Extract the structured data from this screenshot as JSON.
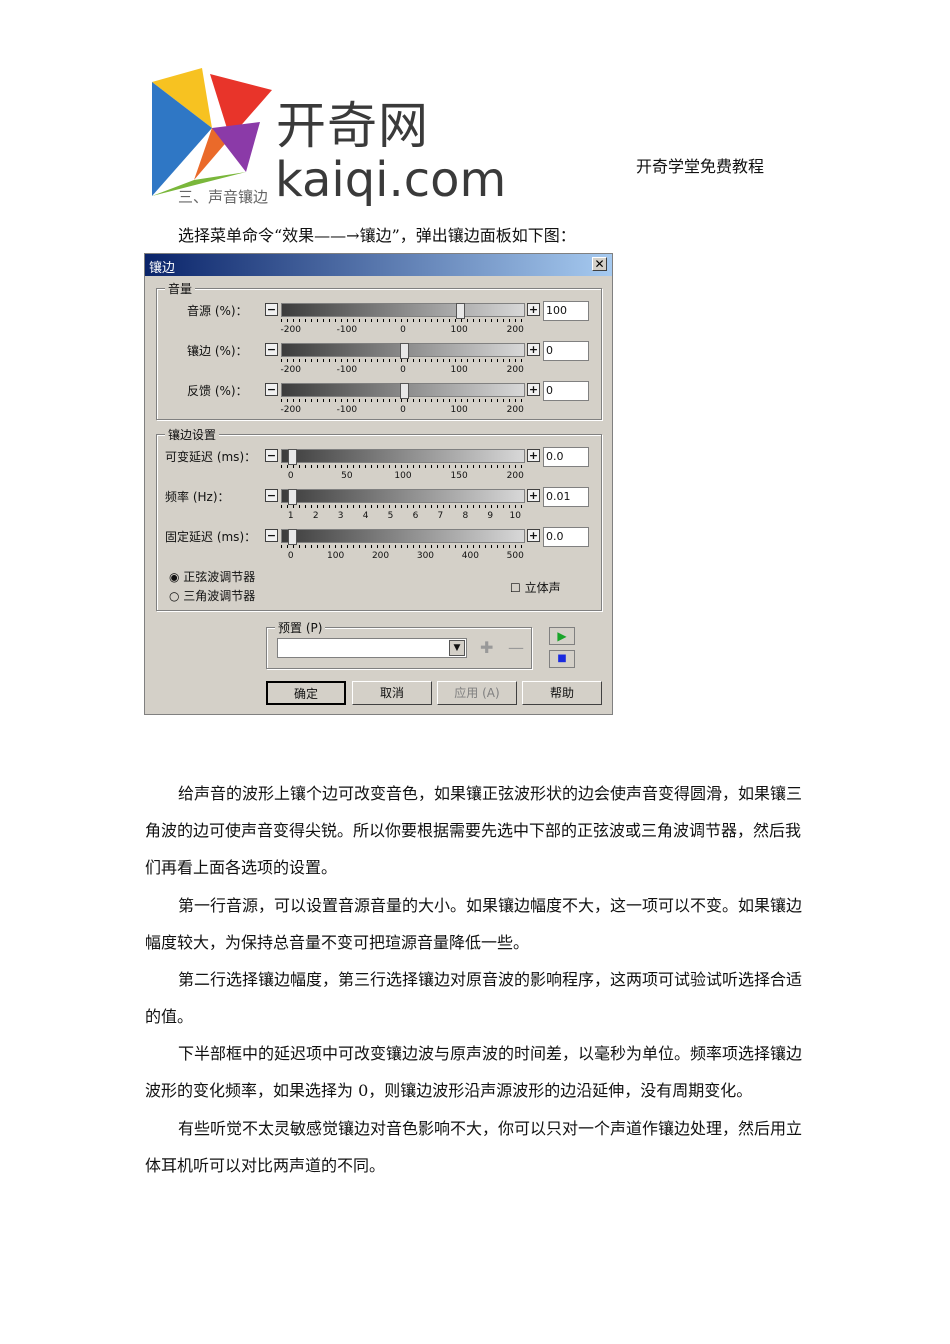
{
  "header": {
    "logo_cn": "开奇网",
    "logo_en": "kaiqi.com",
    "right_text": "开奇学堂免费教程",
    "section_title": "三、声音镶边",
    "intro": "选择菜单命令“效果——→镶边”，弹出镶边面板如下图："
  },
  "dialog": {
    "title": "镶边",
    "close": "✕",
    "volume_group": "音量",
    "volume_sliders": [
      {
        "label": "音源 (%)：",
        "value": "100",
        "ticks": [
          "-200",
          "-100",
          "0",
          "100",
          "200"
        ],
        "level": 100,
        "min": -200,
        "max": 200
      },
      {
        "label": "镶边 (%)：",
        "value": "0",
        "ticks": [
          "-200",
          "-100",
          "0",
          "100",
          "200"
        ],
        "level": 0,
        "min": -200,
        "max": 200
      },
      {
        "label": "反馈 (%)：",
        "value": "0",
        "ticks": [
          "-200",
          "-100",
          "0",
          "100",
          "200"
        ],
        "level": 0,
        "min": -200,
        "max": 200
      }
    ],
    "flange_group": "镶边设置",
    "flange_sliders": [
      {
        "label": "可变延迟 (ms)：",
        "value": "0.0",
        "ticks": [
          "0",
          "50",
          "100",
          "150",
          "200"
        ]
      },
      {
        "label": "频率 (Hz)：",
        "value": "0.01",
        "ticks": [
          "1",
          "2",
          "3",
          "4",
          "5",
          "6",
          "7",
          "8",
          "9",
          "10"
        ]
      },
      {
        "label": "固定延迟 (ms)：",
        "value": "0.0",
        "ticks": [
          "0",
          "100",
          "200",
          "300",
          "400",
          "500"
        ]
      }
    ],
    "radio_sine": "正弦波调节器",
    "radio_triangle": "三角波调节器",
    "stereo": "立体声",
    "preset_group": "预置 (P)",
    "ok": "确定",
    "cancel": "取消",
    "apply": "应用 (A)",
    "help": "帮助"
  },
  "paragraphs": [
    "给声音的波形上镶个边可改变音色，如果镶正弦波形状的边会使声音变得圆滑，如果镶三角波的边可使声音变得尖锐。所以你要根据需要先选中下部的正弦波或三角波调节器，然后我们再看上面各选项的设置。",
    "第一行音源，可以设置音源音量的大小。如果镶边幅度不大，这一项可以不变。如果镶边幅度较大，为保持总音量不变可把瑄源音量降低一些。",
    "第二行选择镶边幅度，第三行选择镶边对原音波的影响程序，这两项可试验试听选择合适的值。",
    "下半部框中的延迟项中可改变镶边波与原声波的时间差，以毫秒为单位。频率项选择镶边波形的变化频率，如果选择为 0，则镶边波形沿声源波形的边沿延伸，没有周期变化。",
    "有些听觉不太灵敏感觉镶边对音色影响不大，你可以只对一个声道作镶边处理，然后用立体耳机听可以对比两声道的不同。"
  ]
}
